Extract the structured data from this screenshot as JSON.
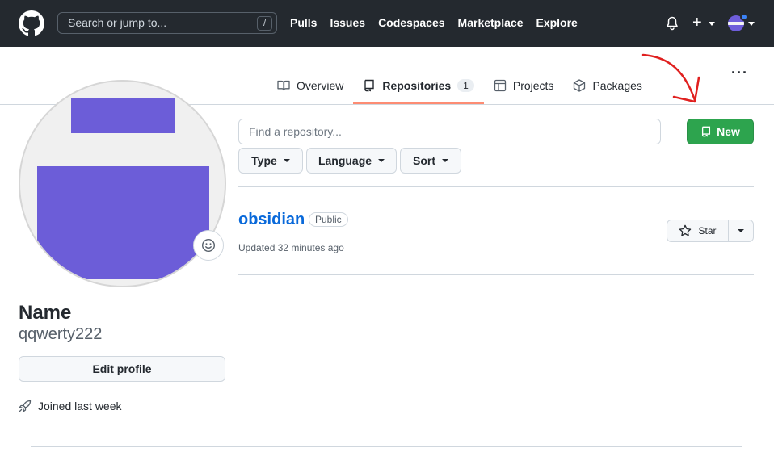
{
  "header": {
    "search_placeholder": "Search or jump to...",
    "search_shortcut": "/",
    "nav": [
      "Pulls",
      "Issues",
      "Codespaces",
      "Marketplace",
      "Explore"
    ],
    "plus_symbol": "+"
  },
  "tabs": [
    {
      "label": "Overview",
      "icon": "book-icon"
    },
    {
      "label": "Repositories",
      "icon": "repo-icon",
      "count": "1",
      "active": true
    },
    {
      "label": "Projects",
      "icon": "table-icon"
    },
    {
      "label": "Packages",
      "icon": "package-icon"
    }
  ],
  "profile": {
    "name": "Name",
    "login": "qqwerty222",
    "edit_label": "Edit profile",
    "joined": "Joined last week",
    "avatar_color": "#6c5dd8"
  },
  "repos": {
    "find_placeholder": "Find a repository...",
    "new_label": "New",
    "filters": [
      "Type",
      "Language",
      "Sort"
    ],
    "items": [
      {
        "name": "obsidian",
        "visibility": "Public",
        "updated": "Updated 32 minutes ago",
        "star_label": "Star"
      }
    ]
  },
  "colors": {
    "header_bg": "#24292f",
    "accent_green": "#2da44e",
    "link_blue": "#0969da",
    "tab_underline": "#fd8c73",
    "annotation_red": "#e0201f"
  }
}
